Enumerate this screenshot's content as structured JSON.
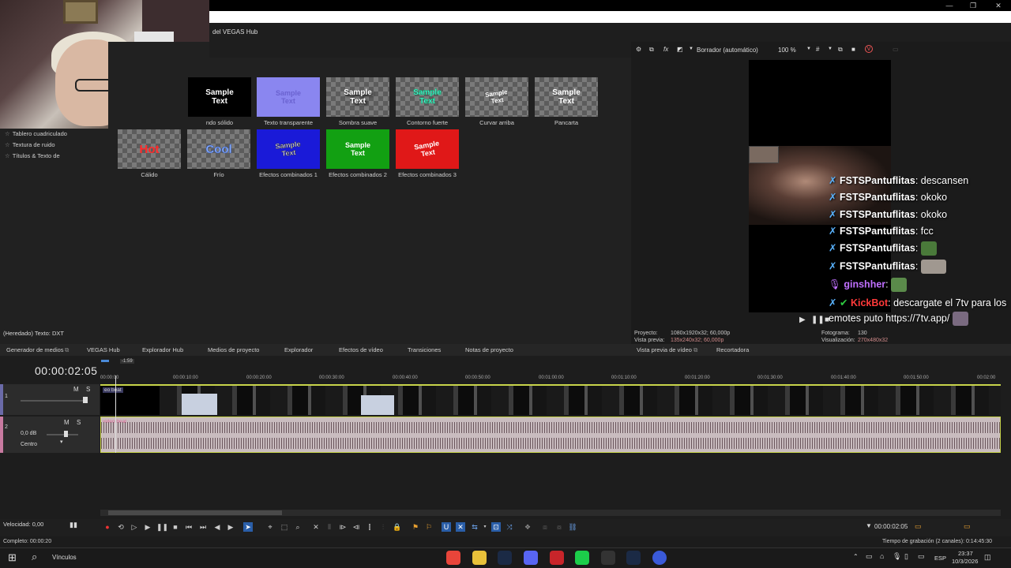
{
  "window": {
    "hub_title": "del VEGAS Hub",
    "controls": [
      "—",
      "❐",
      "✕"
    ]
  },
  "left_panel": {
    "items": [
      "Tablero cuadriculado",
      "Textura de ruido",
      "Títulos & Texto de"
    ]
  },
  "presets": {
    "row1": [
      {
        "label": "ndo sólido",
        "text": "Sample Text",
        "text_color": "#ffffff",
        "bg": "#000000"
      },
      {
        "label": "Texto transparente",
        "text": "Sample Text",
        "text_color": "#7a70d8",
        "bg": "#8a86f0"
      },
      {
        "label": "Sombra suave",
        "text": "Sample Text",
        "text_color": "#ffffff",
        "bg": ""
      },
      {
        "label": "Contorno fuerte",
        "text": "Sample Text",
        "text_color": "#66ffee",
        "bg": ""
      },
      {
        "label": "Curvar arriba",
        "text": "Sample Text",
        "text_color": "#ffffff",
        "bg": ""
      },
      {
        "label": "Pancarta",
        "text": "Sample Text",
        "text_color": "#ffffff",
        "bg": ""
      }
    ],
    "row2": [
      {
        "label": "Cálido",
        "text": "Hot",
        "text_color": "#ff2a2a",
        "bg": ""
      },
      {
        "label": "Frío",
        "text": "Cool",
        "text_color": "#7aa8ff",
        "bg": ""
      },
      {
        "label": "Efectos combinados 1",
        "text": "Sample Text",
        "text_color": "#ffffff",
        "bg": "#1a1ad8"
      },
      {
        "label": "Efectos combinados 2",
        "text": "Sample Text",
        "text_color": "#ffffff",
        "bg": "#12a012"
      },
      {
        "label": "Efectos combinados 3",
        "text": "Sample Text",
        "text_color": "#ffffff",
        "bg": "#e01818"
      }
    ]
  },
  "status_left": "(Heredado) Texto: DXT",
  "preview": {
    "toolbar": {
      "mode": "Borrador (automático)",
      "zoom": "100 %"
    },
    "info": {
      "proyecto_label": "Proyecto:",
      "proyecto_value": "1080x1920x32; 60,000p",
      "vista_label": "Vista previa:",
      "vista_value": "135x240x32; 60,000p",
      "fotograma_label": "Fotograma:",
      "fotograma_value": "130",
      "visualizacion_label": "Visualización:",
      "visualizacion_value": "270x480x32"
    },
    "chat": [
      {
        "user": "FSTSPantuflitas",
        "msg": ": descansen",
        "user_color": "#ffffff"
      },
      {
        "user": "FSTSPantuflitas",
        "msg": ": okoko",
        "user_color": "#ffffff"
      },
      {
        "user": "FSTSPantuflitas",
        "msg": ": okoko",
        "user_color": "#ffffff"
      },
      {
        "user": "FSTSPantuflitas",
        "msg": ": fcc",
        "user_color": "#ffffff"
      },
      {
        "user": "FSTSPantuflitas",
        "msg": ":",
        "user_color": "#ffffff"
      },
      {
        "user": "FSTSPantuflitas",
        "msg": ":",
        "user_color": "#ffffff"
      },
      {
        "user": "ginshher",
        "msg": ":",
        "user_color": "#c070ff"
      },
      {
        "user": "KickBot",
        "msg": ": descargate el 7tv para los",
        "user_color": "#ff3a3a"
      }
    ],
    "chat_continuation": "emotes puto https://7tv.app/"
  },
  "tabs": {
    "left": [
      "Generador de medios",
      "VEGAS Hub",
      "Explorador Hub",
      "Medios de proyecto",
      "Explorador",
      "Efectos de vídeo",
      "Transiciones",
      "Notas de proyecto"
    ],
    "right": [
      "Vista previa de vídeo",
      "Recortadora"
    ]
  },
  "timeline": {
    "timecode": "00:00:02:05",
    "marker": "-1:59",
    "ruler": [
      "00:00:00",
      "00:00:10:00",
      "00:00:20:00",
      "00:00:30:00",
      "00:00:40:00",
      "00:00:50:00",
      "00:01:00:00",
      "00:01:10:00",
      "00:01:20:00",
      "00:01:30:00",
      "00:01:40:00",
      "00:01:50:00",
      "00:02:00"
    ],
    "video_track": {
      "number": "1",
      "clip_label": "eo beat",
      "mute": "M",
      "solo": "S"
    },
    "audio_track": {
      "number": "2",
      "clip_label": "video beat",
      "volume": "0,0 dB",
      "pan": "Centro",
      "mute": "M",
      "solo": "S"
    }
  },
  "transport": {
    "speed": "Velocidad: 0,00",
    "end_timecode": "00:00:02:05"
  },
  "statusbar": {
    "left": "Completo: 00:00:20",
    "right": "Tiempo de grabación (2 canales): 0:14:45:30"
  },
  "taskbar": {
    "search": "Vínculos",
    "lang": "ESP",
    "time": "23:37",
    "date": "10/3/2026"
  }
}
